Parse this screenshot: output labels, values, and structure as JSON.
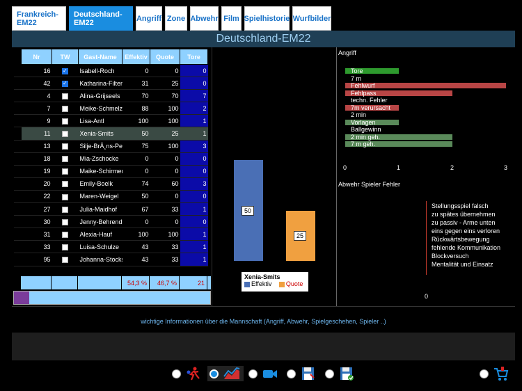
{
  "tabs": [
    "Frankreich-EM22",
    "Deutschland-EM22",
    "Angriff",
    "Zone",
    "Abwehr",
    "Film",
    "Spielhistorie",
    "Wurfbilder"
  ],
  "title": "Deutschland-EM22",
  "table": {
    "headers": [
      "Nr",
      "TW",
      "Gast-Name",
      "Effektiv",
      "Quote",
      "Tore"
    ],
    "rows": [
      {
        "nr": "16",
        "tw": true,
        "name": "Isabell-Roch",
        "eff": "0",
        "quote": "0",
        "tore": "0"
      },
      {
        "nr": "42",
        "tw": true,
        "name": "Katharina-Filter",
        "eff": "31",
        "quote": "25",
        "tore": "0"
      },
      {
        "nr": "4",
        "tw": false,
        "name": "Alina-Grijseels",
        "eff": "70",
        "quote": "70",
        "tore": "7"
      },
      {
        "nr": "7",
        "tw": false,
        "name": "Meike-Schmelzer",
        "eff": "88",
        "quote": "100",
        "tore": "2"
      },
      {
        "nr": "9",
        "tw": false,
        "name": "Lisa-Antl",
        "eff": "100",
        "quote": "100",
        "tore": "1"
      },
      {
        "nr": "11",
        "tw": false,
        "name": "Xenia-Smits",
        "eff": "50",
        "quote": "25",
        "tore": "1"
      },
      {
        "nr": "13",
        "tw": false,
        "name": "Silje-BrÃ¸ns-Petersen",
        "eff": "75",
        "quote": "100",
        "tore": "3"
      },
      {
        "nr": "18",
        "tw": false,
        "name": "Mia-Zschocke",
        "eff": "0",
        "quote": "0",
        "tore": "0"
      },
      {
        "nr": "19",
        "tw": false,
        "name": "Maike-Schirmer",
        "eff": "0",
        "quote": "0",
        "tore": "0"
      },
      {
        "nr": "20",
        "tw": false,
        "name": "Emily-Boelk",
        "eff": "74",
        "quote": "60",
        "tore": "3"
      },
      {
        "nr": "22",
        "tw": false,
        "name": "Maren-Weigel",
        "eff": "50",
        "quote": "0",
        "tore": "0"
      },
      {
        "nr": "27",
        "tw": false,
        "name": "Julia-Maidhof",
        "eff": "67",
        "quote": "33",
        "tore": "1"
      },
      {
        "nr": "30",
        "tw": false,
        "name": "Jenny-Behrend",
        "eff": "0",
        "quote": "0",
        "tore": "0"
      },
      {
        "nr": "31",
        "tw": false,
        "name": "Alexia-Hauf",
        "eff": "100",
        "quote": "100",
        "tore": "1"
      },
      {
        "nr": "33",
        "tw": false,
        "name": "Luisa-Schulze",
        "eff": "43",
        "quote": "33",
        "tore": "1"
      },
      {
        "nr": "95",
        "tw": false,
        "name": "Johanna-Stockschläder",
        "eff": "43",
        "quote": "33",
        "tore": "1"
      }
    ],
    "selected_index": 5,
    "footer": {
      "eff": "54,3 %",
      "quote": "46,7 %",
      "tore": "21"
    }
  },
  "player_chart": {
    "player": "Xenia-Smits",
    "effektiv": 50,
    "quote": 25,
    "legend_effektiv": "Effektiv",
    "legend_quote": "Quote",
    "colors": {
      "effektiv": "#4a6fb5",
      "quote": "#f0a040"
    }
  },
  "angriff": {
    "title": "Angriff",
    "items": [
      {
        "label": "Tore",
        "value": 1,
        "color": "#2e9a2e"
      },
      {
        "label": "7 m",
        "value": 0,
        "color": "#2e9a2e"
      },
      {
        "label": "Fehlwurf",
        "value": 3,
        "color": "#b84545"
      },
      {
        "label": "Fehlpass",
        "value": 2,
        "color": "#b84545"
      },
      {
        "label": "techn. Fehler",
        "value": 0,
        "color": "#b84545"
      },
      {
        "label": "7m verursacht",
        "value": 1,
        "color": "#b84545"
      },
      {
        "label": "2 min",
        "value": 0,
        "color": "#b84545"
      },
      {
        "label": "Vorlagen",
        "value": 1,
        "color": "#5a8a5a"
      },
      {
        "label": "Ballgewinn",
        "value": 0,
        "color": "#5a8a5a"
      },
      {
        "label": "2 min geh.",
        "value": 2,
        "color": "#5a8a5a"
      },
      {
        "label": "7 m geh.",
        "value": 2,
        "color": "#5a8a5a"
      }
    ],
    "ticks": [
      "0",
      "1",
      "2",
      "3"
    ]
  },
  "abwehr": {
    "title": "Abwehr Spieler Fehler",
    "items": [
      "Stellungsspiel falsch",
      "zu spätes übernehmen",
      "zu passiv - Arme unten",
      "eins gegen eins verloren",
      "Rückwärtsbewegung",
      "fehlende Kommunikation",
      "Blockversuch",
      "Mentalität und Einsatz"
    ],
    "axis_zero": "0"
  },
  "info_text": "wichtige Informationen über die Mannschaft (Angriff, Abwehr, Spielgeschehen, Spieler ..)",
  "toolbar_icons": [
    "handball-player-icon",
    "chart-icon",
    "video-camera-icon",
    "save-icon",
    "save-check-icon",
    "cart-icon"
  ]
}
